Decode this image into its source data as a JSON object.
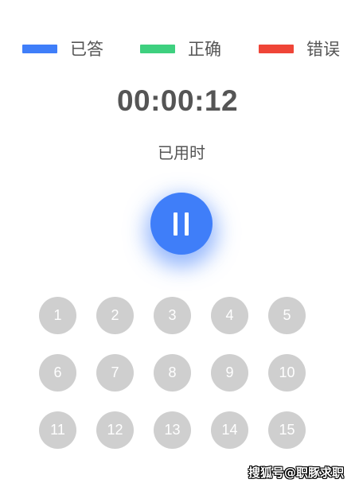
{
  "legend": {
    "items": [
      {
        "label": "已答",
        "color": "#3f7ef9"
      },
      {
        "label": "正确",
        "color": "#3ed07f"
      },
      {
        "label": "错误",
        "color": "#ef4537"
      }
    ]
  },
  "timer": {
    "value": "00:00:12",
    "caption": "已用时"
  },
  "pause_button": {
    "icon": "pause-icon",
    "color": "#3f7ef9"
  },
  "question_grid": {
    "items": [
      "1",
      "2",
      "3",
      "4",
      "5",
      "6",
      "7",
      "8",
      "9",
      "10",
      "11",
      "12",
      "13",
      "14",
      "15"
    ],
    "circle_color": "#cfcfcf"
  },
  "watermark": {
    "text": "搜狐号@职豚求职"
  }
}
